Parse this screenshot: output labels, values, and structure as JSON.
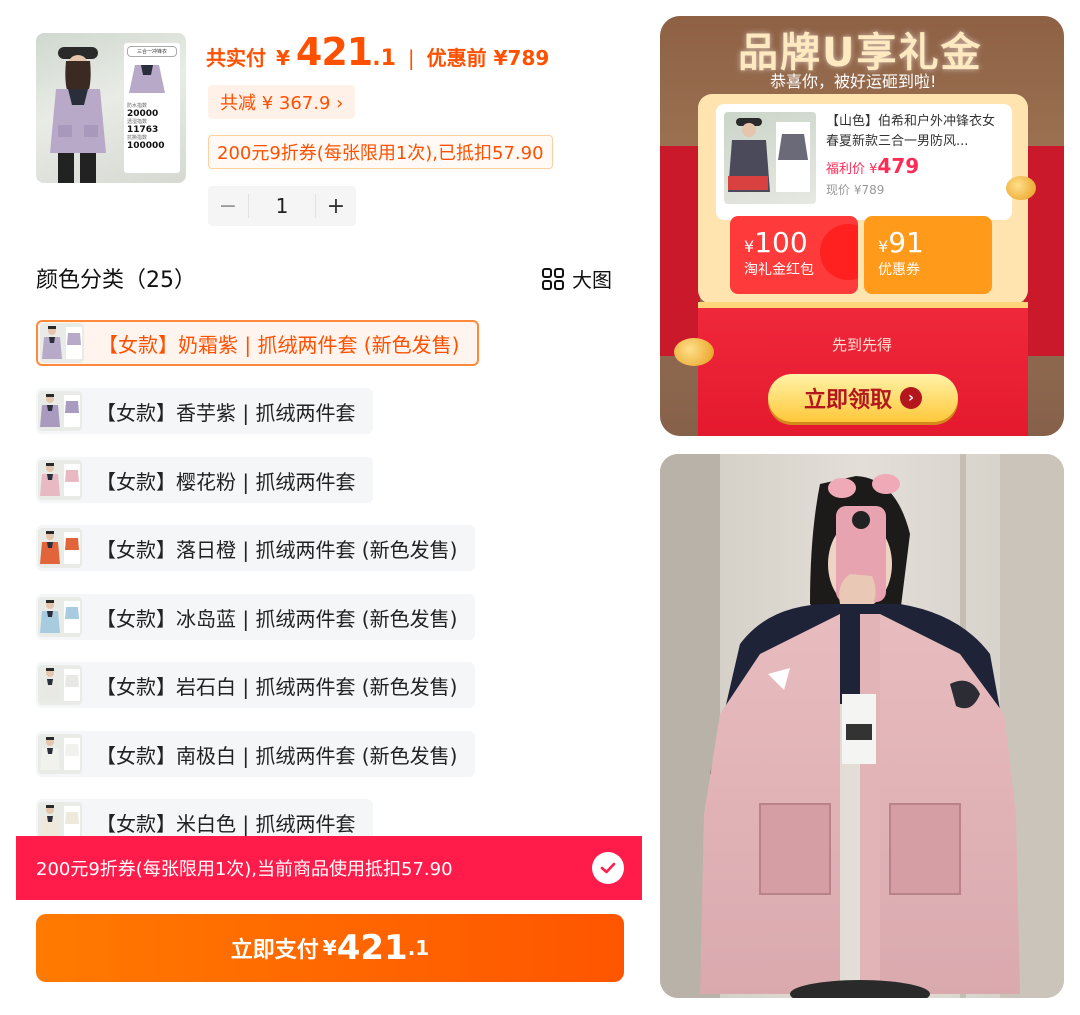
{
  "order": {
    "paid_label": "共实付",
    "currency": "¥",
    "paid_int": "421",
    "paid_dec": ".1",
    "separator": "|",
    "before_label": "优惠前 ¥789",
    "total_reduction": "共减 ¥ 367.9 ›",
    "coupon_tag": "200元9折券(每张限用1次),已抵扣57.90",
    "quantity": "1",
    "minus": "−",
    "plus": "+"
  },
  "main_thumb": {
    "card_title": "三合一冲锋衣",
    "stat1_label": "防水指数",
    "stat1_value": "20000",
    "stat2_label": "透湿指数",
    "stat2_value": "11763",
    "stat3_label": "抗撕指数",
    "stat3_value": "100000"
  },
  "colors": {
    "title": "颜色分类（25）",
    "big_view": "大图",
    "options": [
      {
        "label": "【女款】奶霜紫 | 抓绒两件套 (新色发售)",
        "swatch": "#b7a9c8",
        "selected": true
      },
      {
        "label": "【女款】香芋紫 | 抓绒两件套",
        "swatch": "#a89bbf",
        "selected": false
      },
      {
        "label": "【女款】樱花粉 | 抓绒两件套",
        "swatch": "#e9b9c3",
        "selected": false
      },
      {
        "label": "【女款】落日橙 | 抓绒两件套 (新色发售)",
        "swatch": "#e2643a",
        "selected": false
      },
      {
        "label": "【女款】冰岛蓝 | 抓绒两件套 (新色发售)",
        "swatch": "#a9cbe0",
        "selected": false
      },
      {
        "label": "【女款】岩石白 | 抓绒两件套 (新色发售)",
        "swatch": "#e8e8e4",
        "selected": false
      },
      {
        "label": "【女款】南极白 | 抓绒两件套 (新色发售)",
        "swatch": "#f1f1ee",
        "selected": false
      },
      {
        "label": "【女款】米白色 | 抓绒两件套",
        "swatch": "#efe9dc",
        "selected": false
      }
    ]
  },
  "coupon_bar": {
    "text": "200元9折券(每张限用1次),当前商品使用抵扣57.90"
  },
  "pay_button": {
    "label": "立即支付",
    "currency": "¥",
    "int": "421",
    "dec": ".1"
  },
  "promo": {
    "banner": "品牌U享礼金",
    "congrats": "恭喜你，被好运砸到啦!",
    "product_title": "【山色】伯希和户外冲锋衣女春夏新款三合一男防风...",
    "welfare_label": "福利价 ¥",
    "welfare_price": "479",
    "current_price": "现价 ¥789",
    "voucher1_amount": "100",
    "voucher1_label": "淘礼金红包",
    "voucher2_amount": "91",
    "voucher2_label": "优惠券",
    "first_come": "先到先得",
    "claim_label": "立即领取",
    "currency": "¥"
  },
  "colors_theme": {
    "accent_orange": "#ff5000",
    "coupon_red": "#ff1c4b",
    "promo_red": "#e4192e"
  }
}
